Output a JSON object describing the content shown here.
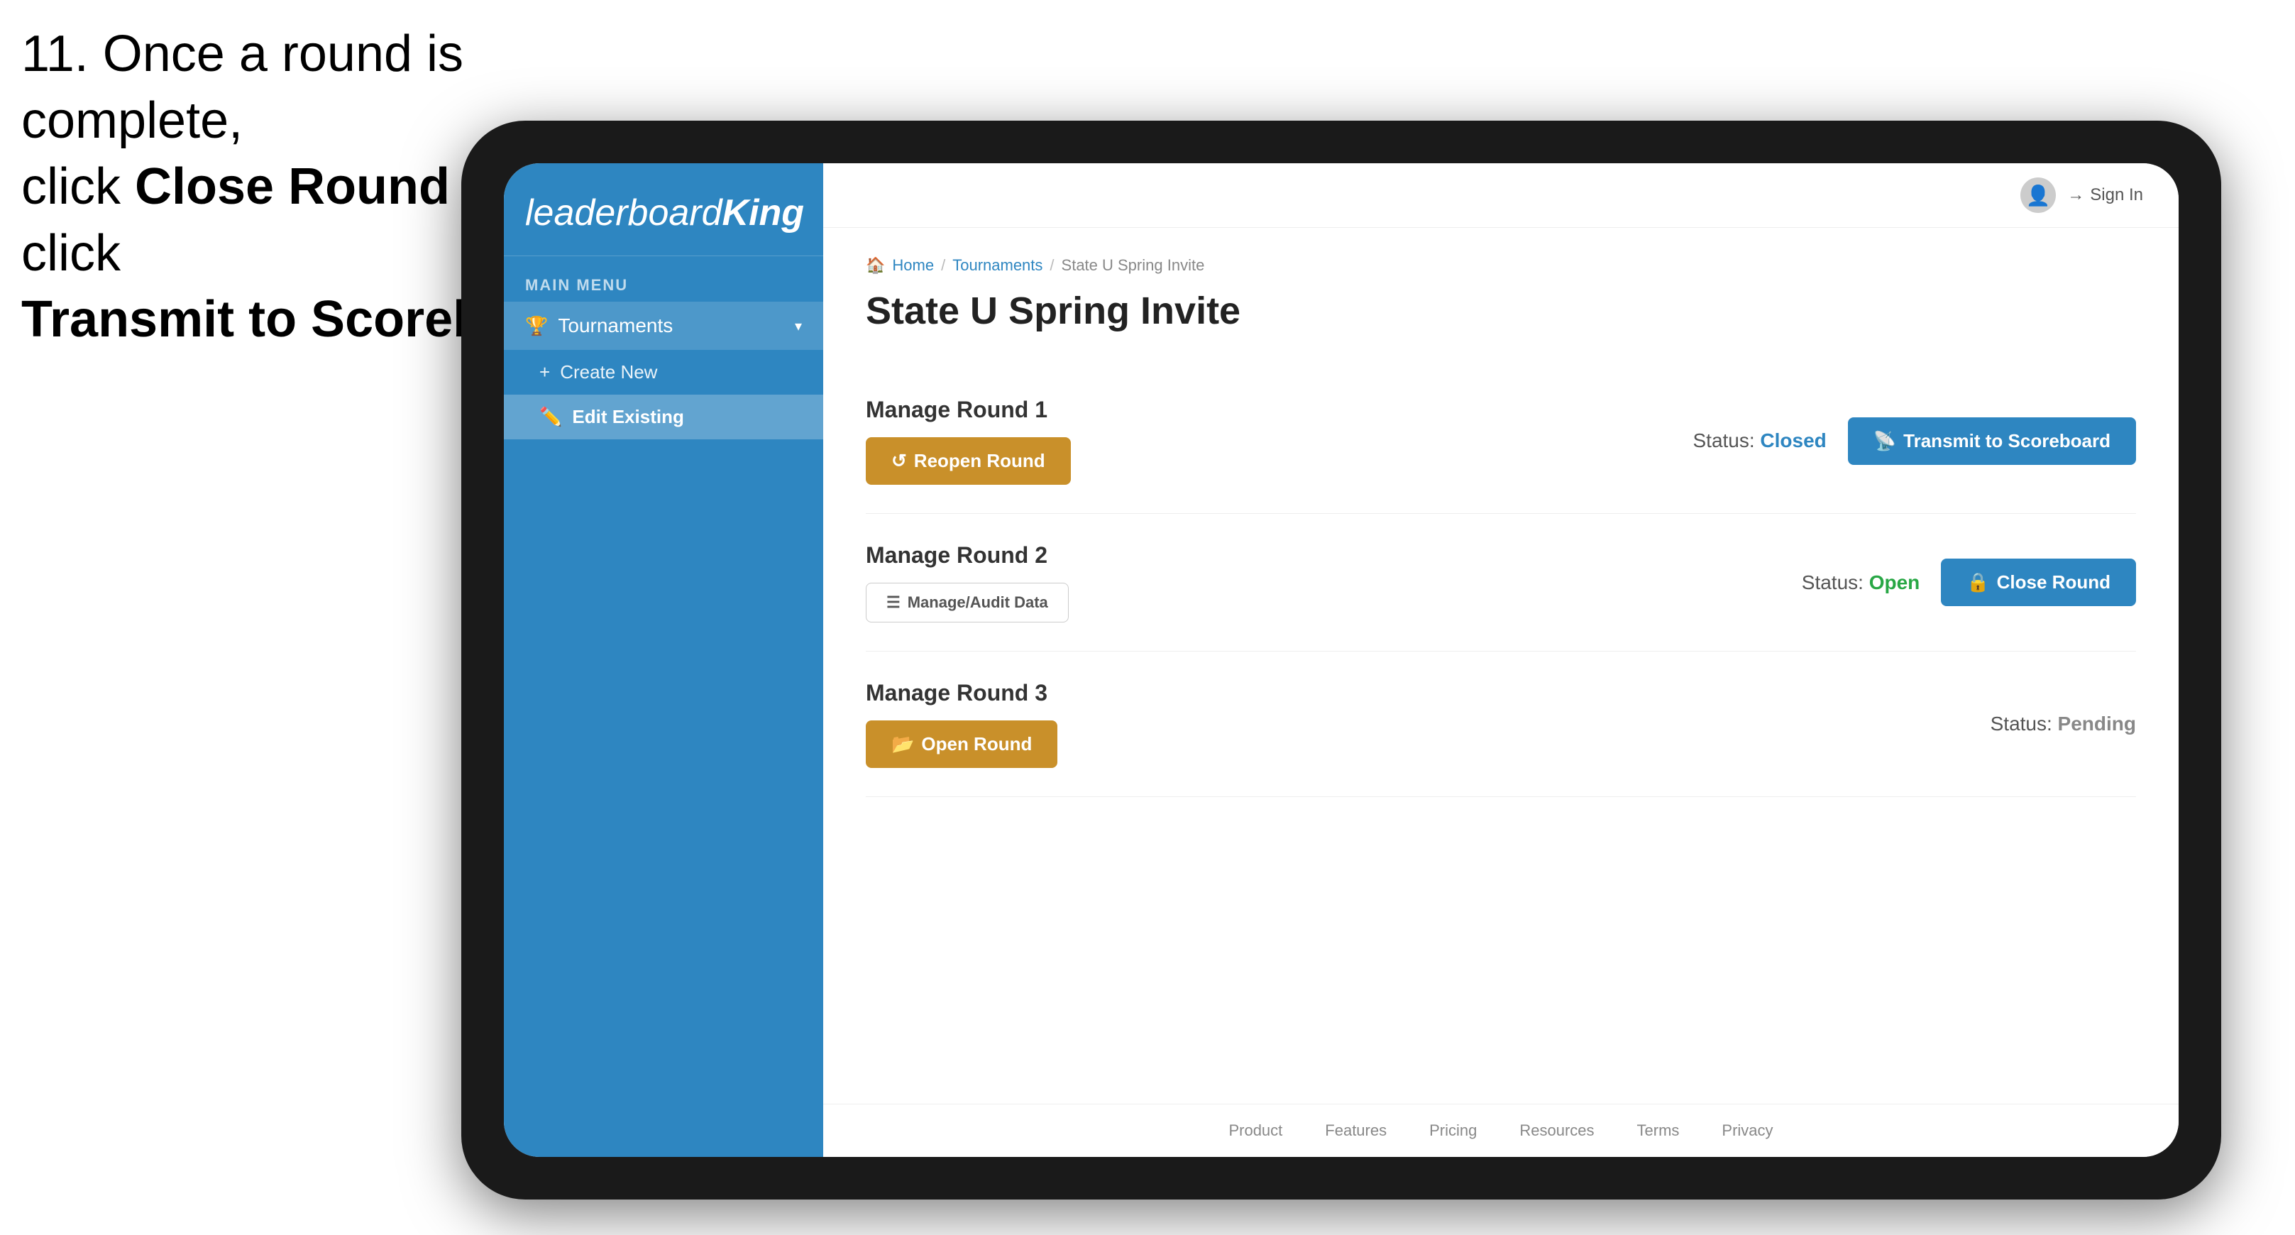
{
  "instruction": {
    "line1": "11. Once a round is complete,",
    "line2": "click ",
    "bold1": "Close Round",
    "line3": " then click",
    "bold2": "Transmit to Scoreboard."
  },
  "app": {
    "logo": "leaderboard",
    "logo_king": "King",
    "main_menu_label": "MAIN MENU"
  },
  "sidebar": {
    "nav_items": [
      {
        "label": "Tournaments",
        "icon": "🏆",
        "active": true,
        "has_chevron": true
      }
    ],
    "sub_items": [
      {
        "label": "Create New",
        "icon": "+",
        "selected": false
      },
      {
        "label": "Edit Existing",
        "icon": "✏️",
        "selected": true
      }
    ]
  },
  "topbar": {
    "sign_in_label": "Sign In"
  },
  "breadcrumb": {
    "home": "Home",
    "sep1": "/",
    "tournaments": "Tournaments",
    "sep2": "/",
    "current": "State U Spring Invite"
  },
  "page": {
    "title": "State U Spring Invite"
  },
  "rounds": [
    {
      "id": "round1",
      "title": "Manage Round 1",
      "status_label": "Status:",
      "status_value": "Closed",
      "status_class": "closed",
      "left_button": "Reopen Round",
      "right_button": "Transmit to Scoreboard",
      "left_btn_class": "btn-gold",
      "right_btn_class": "btn-blue"
    },
    {
      "id": "round2",
      "title": "Manage Round 2",
      "status_label": "Status:",
      "status_value": "Open",
      "status_class": "open",
      "left_button": "Manage/Audit Data",
      "right_button": "Close Round",
      "left_btn_class": "btn-blue-outline",
      "right_btn_class": "btn-blue"
    },
    {
      "id": "round3",
      "title": "Manage Round 3",
      "status_label": "Status:",
      "status_value": "Pending",
      "status_class": "pending",
      "left_button": "Open Round",
      "right_button": null,
      "left_btn_class": "btn-gold",
      "right_btn_class": null
    }
  ],
  "footer": {
    "links": [
      "Product",
      "Features",
      "Pricing",
      "Resources",
      "Terms",
      "Privacy"
    ]
  }
}
